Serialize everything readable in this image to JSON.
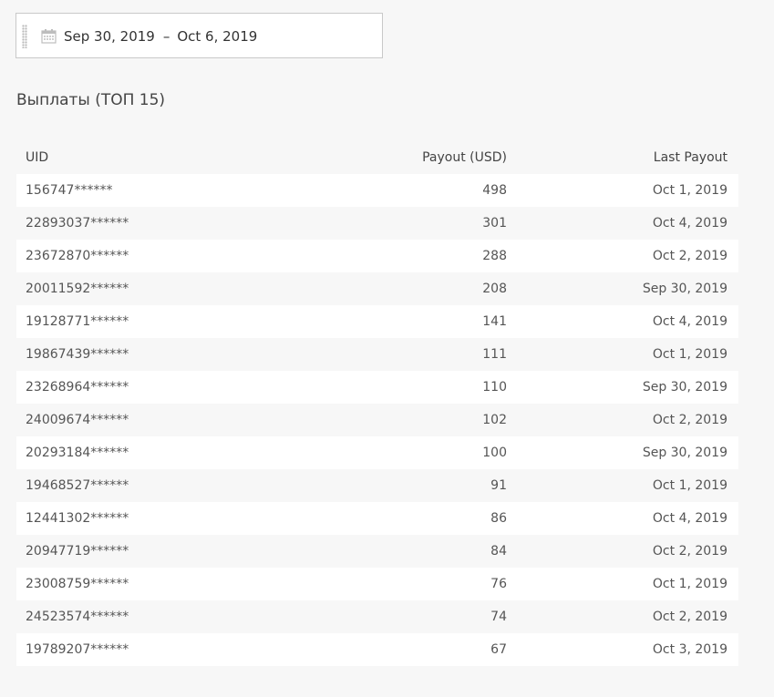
{
  "date_range": {
    "start": "Sep 30, 2019",
    "separator": "–",
    "end": "Oct 6, 2019",
    "icon": "calendar-icon"
  },
  "section": {
    "title": "Выплаты (ТОП 15)"
  },
  "table": {
    "columns": {
      "uid": "UID",
      "payout": "Payout (USD)",
      "last_payout": "Last Payout"
    },
    "rows": [
      {
        "uid": "156747******",
        "payout": "498",
        "last_payout": "Oct 1, 2019"
      },
      {
        "uid": "22893037******",
        "payout": "301",
        "last_payout": "Oct 4, 2019"
      },
      {
        "uid": "23672870******",
        "payout": "288",
        "last_payout": "Oct 2, 2019"
      },
      {
        "uid": "20011592******",
        "payout": "208",
        "last_payout": "Sep 30, 2019"
      },
      {
        "uid": "19128771******",
        "payout": "141",
        "last_payout": "Oct 4, 2019"
      },
      {
        "uid": "19867439******",
        "payout": "111",
        "last_payout": "Oct 1, 2019"
      },
      {
        "uid": "23268964******",
        "payout": "110",
        "last_payout": "Sep 30, 2019"
      },
      {
        "uid": "24009674******",
        "payout": "102",
        "last_payout": "Oct 2, 2019"
      },
      {
        "uid": "20293184******",
        "payout": "100",
        "last_payout": "Sep 30, 2019"
      },
      {
        "uid": "19468527******",
        "payout": "91",
        "last_payout": "Oct 1, 2019"
      },
      {
        "uid": "12441302******",
        "payout": "86",
        "last_payout": "Oct 4, 2019"
      },
      {
        "uid": "20947719******",
        "payout": "84",
        "last_payout": "Oct 2, 2019"
      },
      {
        "uid": "23008759******",
        "payout": "76",
        "last_payout": "Oct 1, 2019"
      },
      {
        "uid": "24523574******",
        "payout": "74",
        "last_payout": "Oct 2, 2019"
      },
      {
        "uid": "19789207******",
        "payout": "67",
        "last_payout": "Oct 3, 2019"
      }
    ]
  }
}
